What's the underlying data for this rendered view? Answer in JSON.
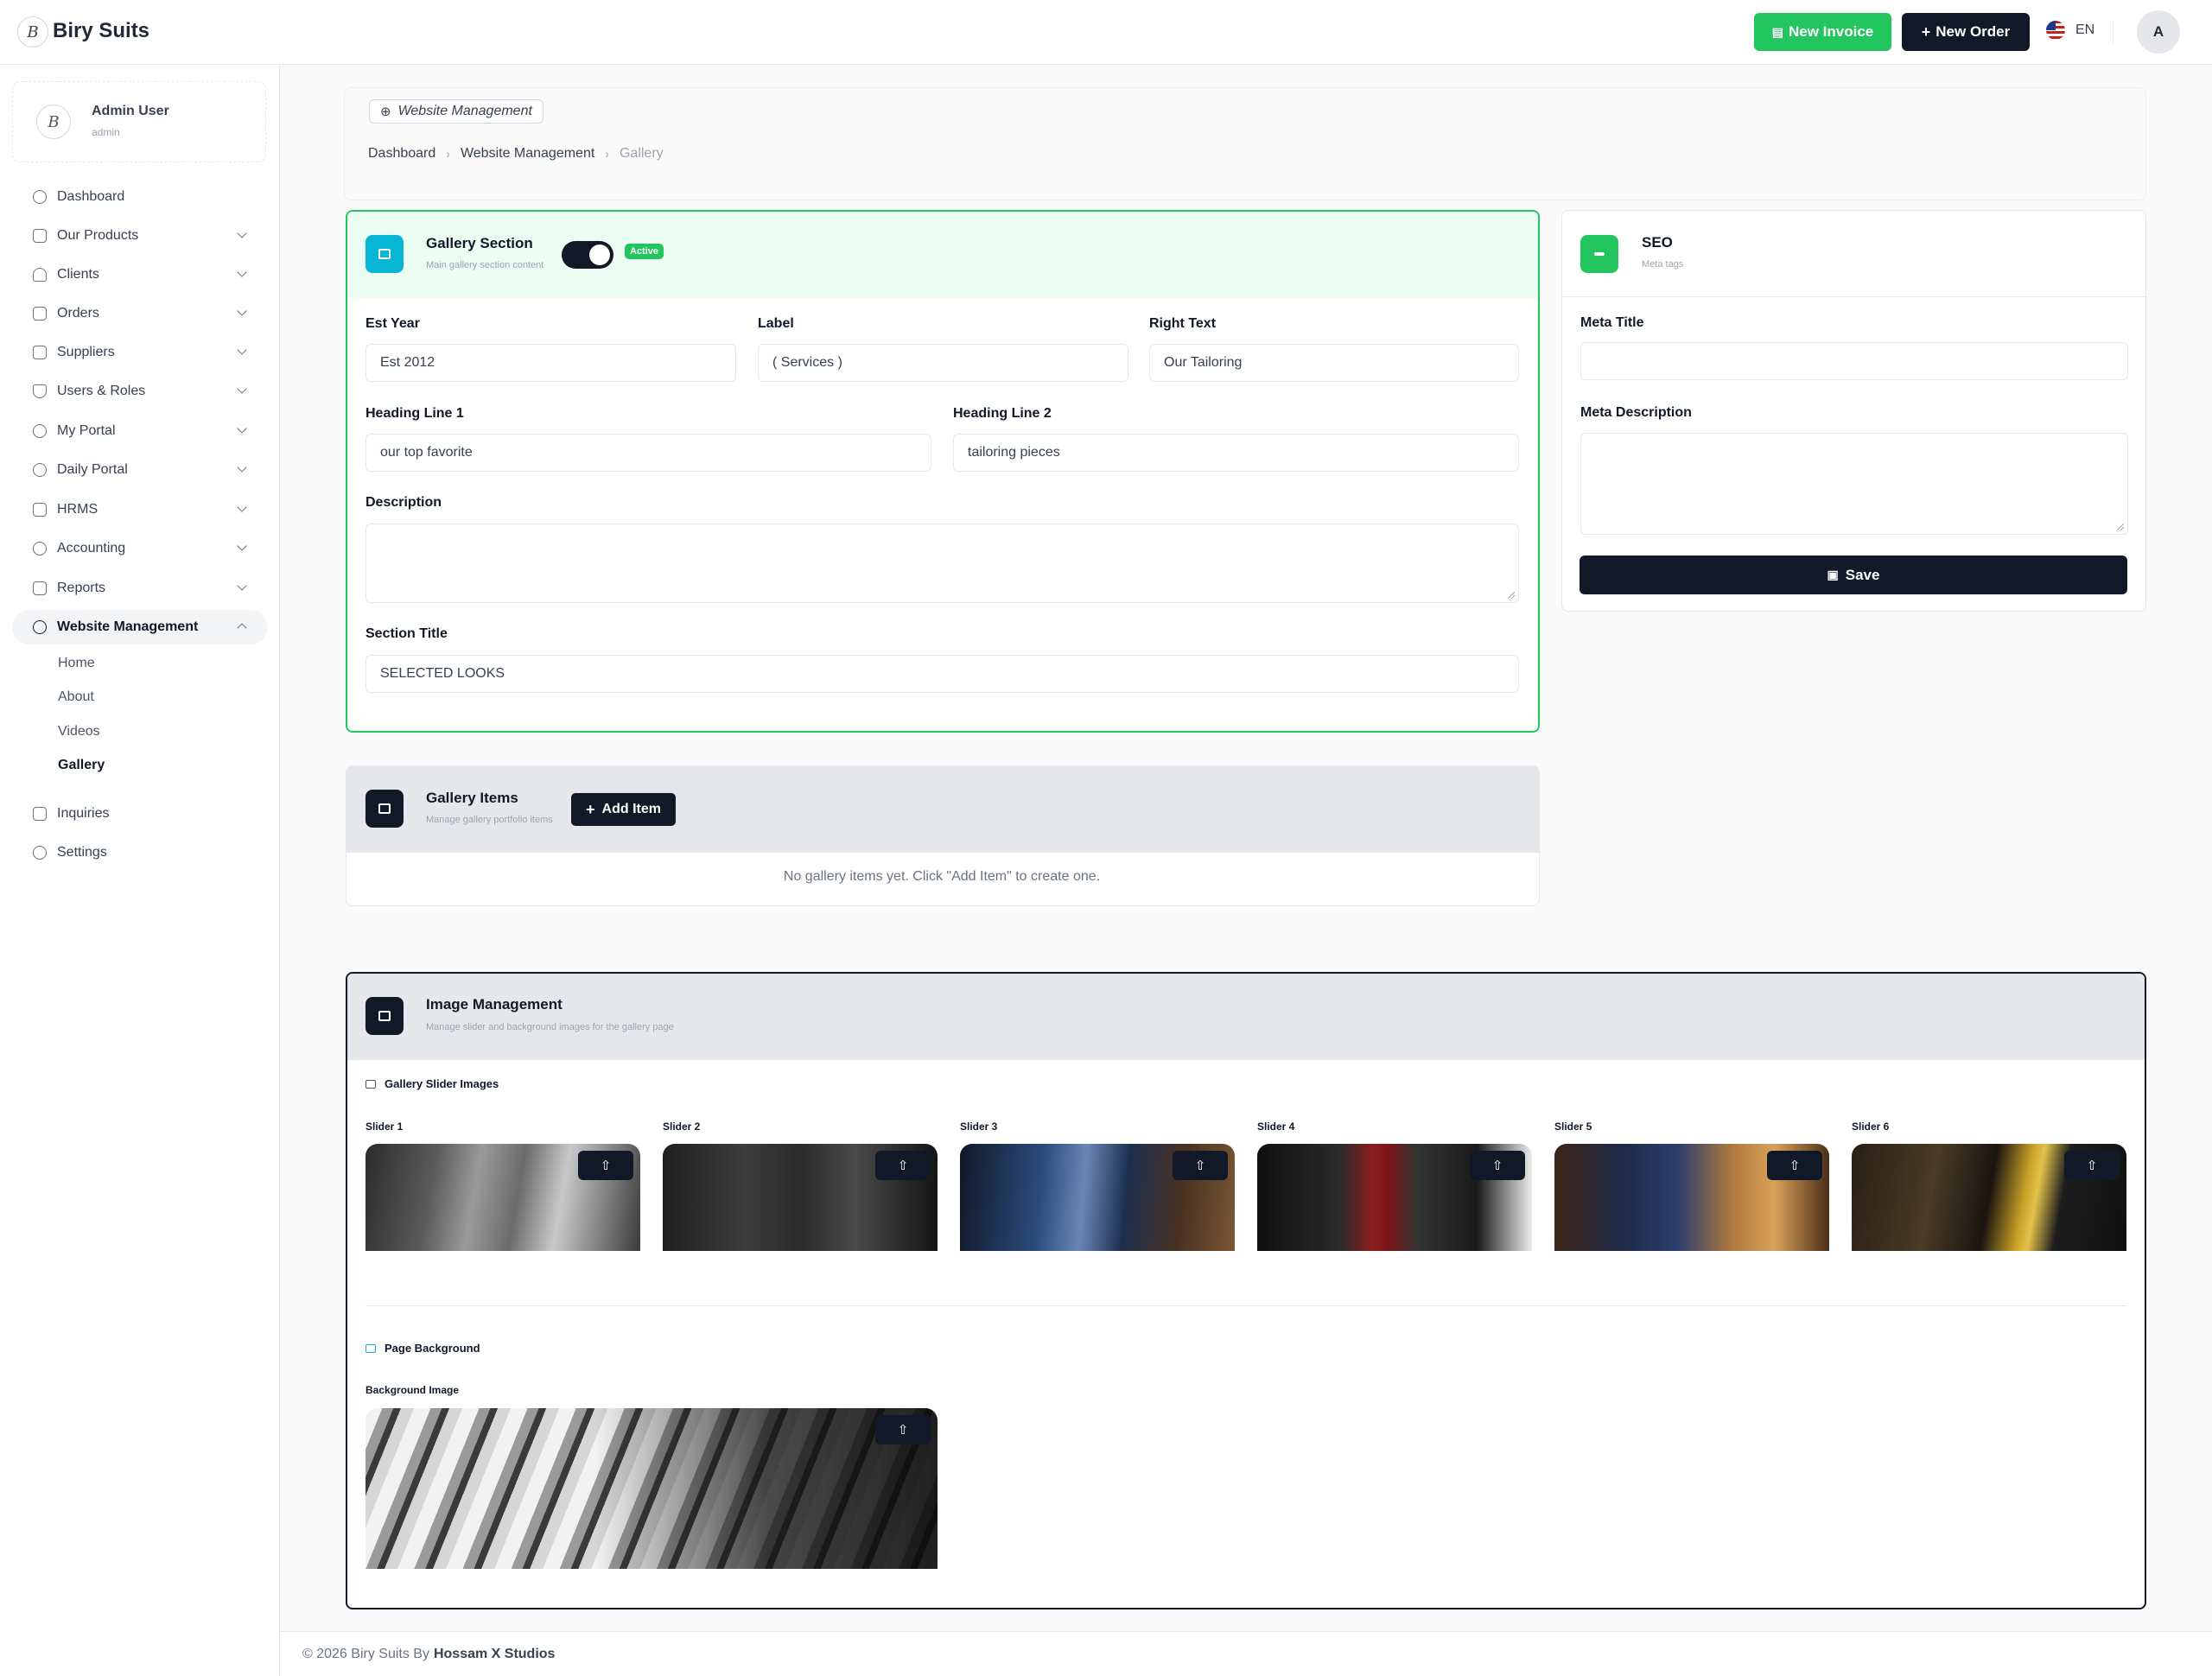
{
  "app": {
    "brand": "Biry Suits",
    "logo_letter": "B"
  },
  "topbar": {
    "new_invoice": "New Invoice",
    "new_order": "New Order",
    "lang": "EN",
    "avatar": "A"
  },
  "user": {
    "name": "Admin User",
    "role": "admin"
  },
  "nav": {
    "items": [
      {
        "label": "Dashboard",
        "icon": "dashboard-icon",
        "chevron": false
      },
      {
        "label": "Our Products",
        "icon": "box-icon",
        "chevron": true
      },
      {
        "label": "Clients",
        "icon": "user-icon",
        "chevron": true
      },
      {
        "label": "Orders",
        "icon": "cart-icon",
        "chevron": true
      },
      {
        "label": "Suppliers",
        "icon": "truck-icon",
        "chevron": true
      },
      {
        "label": "Users & Roles",
        "icon": "shield-icon",
        "chevron": true
      },
      {
        "label": "My Portal",
        "icon": "user-circle-icon",
        "chevron": true
      },
      {
        "label": "Daily Portal",
        "icon": "clock-icon",
        "chevron": true
      },
      {
        "label": "HRMS",
        "icon": "users-icon",
        "chevron": true
      },
      {
        "label": "Accounting",
        "icon": "dollar-icon",
        "chevron": true
      },
      {
        "label": "Reports",
        "icon": "chart-icon",
        "chevron": true
      },
      {
        "label": "Website Management",
        "icon": "globe-icon",
        "chevron": true
      },
      {
        "label": "Inquiries",
        "icon": "mail-icon",
        "chevron": false
      },
      {
        "label": "Settings",
        "icon": "gear-icon",
        "chevron": false
      }
    ],
    "website_sub": [
      "Home",
      "About",
      "Videos",
      "Gallery"
    ]
  },
  "header": {
    "pill": "Website Management",
    "breadcrumb": [
      "Dashboard",
      "Website Management",
      "Gallery"
    ]
  },
  "gallery_section": {
    "title": "Gallery Section",
    "subtitle": "Main gallery section content",
    "status": "Active",
    "toggle_on": true,
    "fields": {
      "est_year": {
        "label": "Est Year",
        "value": "Est 2012"
      },
      "label": {
        "label": "Label",
        "value": "( Services )"
      },
      "right_text": {
        "label": "Right Text",
        "value": "Our Tailoring"
      },
      "heading1": {
        "label": "Heading Line 1",
        "value": "our top favorite"
      },
      "heading2": {
        "label": "Heading Line 2",
        "value": "tailoring pieces"
      },
      "description": {
        "label": "Description",
        "value": ""
      },
      "section_title": {
        "label": "Section Title",
        "value": "SELECTED LOOKS"
      }
    }
  },
  "seo": {
    "title": "SEO",
    "subtitle": "Meta tags",
    "meta_title_label": "Meta Title",
    "meta_title_value": "",
    "meta_desc_label": "Meta Description",
    "save": "Save"
  },
  "gallery_items": {
    "title": "Gallery Items",
    "subtitle": "Manage gallery portfolio items",
    "add": "Add Item",
    "empty": "No gallery items yet. Click \"Add Item\" to create one."
  },
  "image_mgmt": {
    "title": "Image Management",
    "subtitle": "Manage slider and background images for the gallery page",
    "slider_section": "Gallery Slider Images",
    "sliders": [
      "Slider 1",
      "Slider 2",
      "Slider 3",
      "Slider 4",
      "Slider 5",
      "Slider 6"
    ],
    "bg_section": "Page Background",
    "bg_label": "Background Image"
  },
  "footer": {
    "prefix": "© 2026 Biry Suits By",
    "studio": "Hossam X Studios"
  },
  "colors": {
    "accent_green": "#22c55e",
    "dark": "#111827",
    "teal": "#06b6d4"
  }
}
